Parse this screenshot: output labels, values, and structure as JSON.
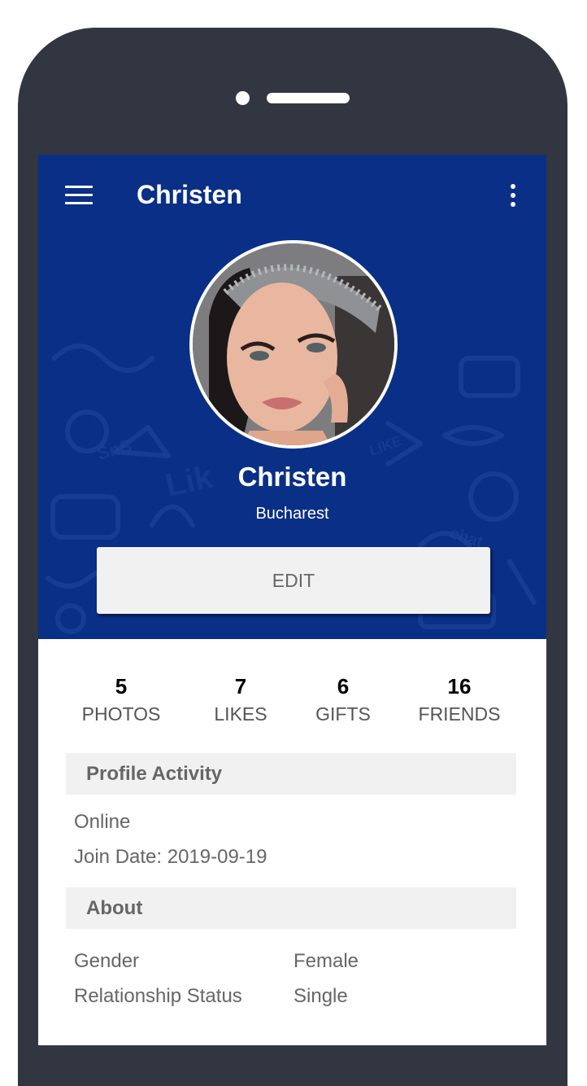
{
  "toolbar": {
    "title": "Christen",
    "menu_icon": "hamburger-menu-icon",
    "overflow_icon": "more-vertical-icon"
  },
  "profile": {
    "name": "Christen",
    "location": "Bucharest",
    "edit_label": "EDIT"
  },
  "stats": [
    {
      "value": "5",
      "label": "PHOTOS"
    },
    {
      "value": "7",
      "label": "LIKES"
    },
    {
      "value": "6",
      "label": "GIFTS"
    },
    {
      "value": "16",
      "label": "FRIENDS"
    }
  ],
  "activity": {
    "title": "Profile Activity",
    "status": "Online",
    "join_date": "Join Date: 2019-09-19"
  },
  "about": {
    "title": "About",
    "rows": [
      {
        "label": "Gender",
        "value": "Female"
      },
      {
        "label": "Relationship Status",
        "value": "Single"
      }
    ]
  },
  "colors": {
    "header_background": "#0a2f86",
    "device_frame": "#323640",
    "section_background": "#f1f1f1",
    "secondary_text": "#666666"
  }
}
